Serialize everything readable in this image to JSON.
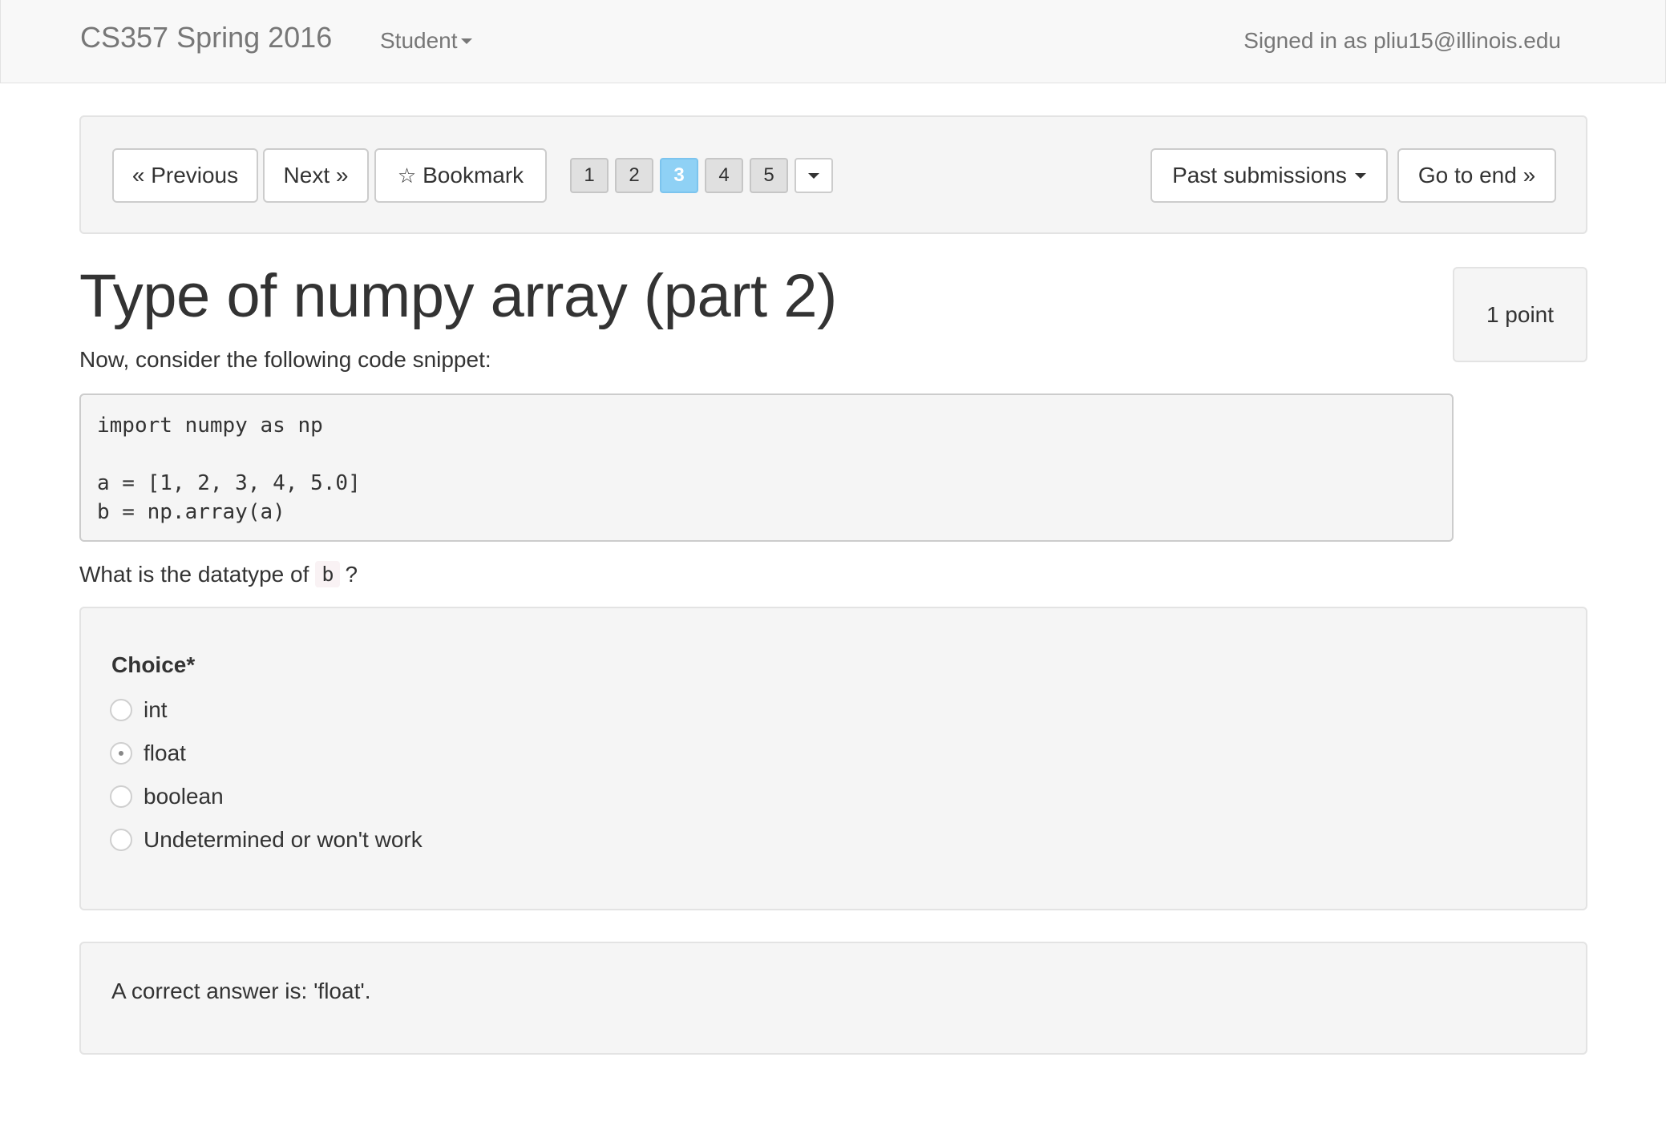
{
  "navbar": {
    "brand": "CS357 Spring 2016",
    "role_menu": "Student",
    "signed_in": "Signed in as pliu15@illinois.edu"
  },
  "question_nav": {
    "previous": "« Previous",
    "next": "Next »",
    "bookmark": "Bookmark",
    "pages": [
      "1",
      "2",
      "3",
      "4",
      "5"
    ],
    "current_page": "3",
    "past_submissions": "Past submissions",
    "go_to_end": "Go to end »"
  },
  "question": {
    "title": "Type of numpy array (part 2)",
    "points": "1 point",
    "intro": "Now, consider the following code snippet:",
    "code": "import numpy as np\n\na = [1, 2, 3, 4, 5.0]\nb = np.array(a)",
    "prompt_before": "What is the datatype of",
    "prompt_code": "b",
    "prompt_after": "?"
  },
  "answer": {
    "label": "Choice*",
    "options": [
      {
        "label": "int",
        "selected": false
      },
      {
        "label": "float",
        "selected": true
      },
      {
        "label": "boolean",
        "selected": false
      },
      {
        "label": "Undetermined or won't work",
        "selected": false
      }
    ]
  },
  "feedback": {
    "text": "A correct answer is: 'float'."
  },
  "colors": {
    "active_page": "#8fd1f5",
    "well_background": "#f5f5f5",
    "navbar_background": "#f8f8f8"
  }
}
